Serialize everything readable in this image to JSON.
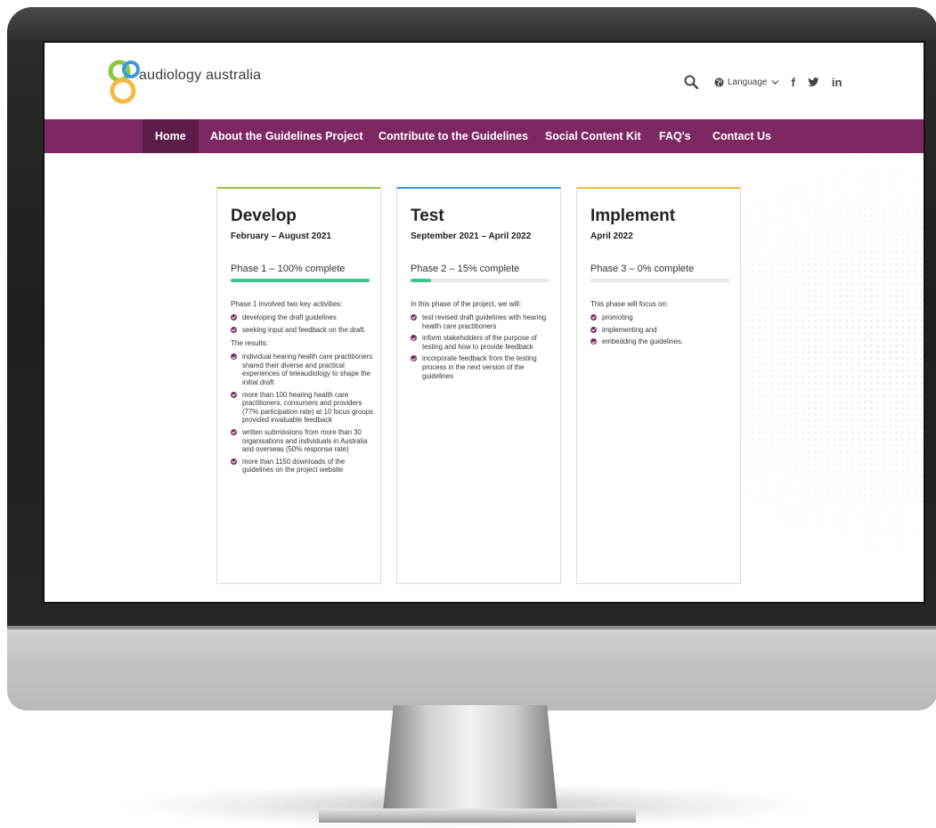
{
  "brand": {
    "name": "audiology australia"
  },
  "header": {
    "language_label": "Language",
    "social": {
      "facebook": "f",
      "linkedin": "in"
    },
    "icons": [
      "search-icon",
      "globe-icon",
      "chevron-down-icon",
      "facebook-icon",
      "twitter-icon",
      "linkedin-icon"
    ]
  },
  "nav": {
    "items": [
      {
        "label": "Home",
        "active": true
      },
      {
        "label": "About the Guidelines Project"
      },
      {
        "label": "Contribute to the Guidelines"
      },
      {
        "label": "Social Content Kit"
      },
      {
        "label": "FAQ's"
      },
      {
        "label": "Contact Us"
      }
    ]
  },
  "colors": {
    "nav_bg": "#7d2862",
    "nav_active_bg": "#5e1c49",
    "progress_fill": "#3cc58f",
    "develop_accent": "#8cc63f",
    "test_accent": "#3a9ad9",
    "implement_accent": "#f4b942"
  },
  "phases": [
    {
      "title": "Develop",
      "dates": "February – August 2021",
      "progress_label": "Phase 1 – 100% complete",
      "progress_percent": 100,
      "intro": "Phase 1 involved two key activities:",
      "items": [
        "developing the draft guidelines",
        "seeking input and feedback on the draft."
      ],
      "results_label": "The results:",
      "results": [
        "individual hearing health care practitioners shared their diverse and practical experiences of teleaudiology to shape the initial draft",
        "more than 100 hearing health care practitioners, consumers and providers (77% participation rate) at 10 focus groups provided invaluable feedback",
        "written submissions from more than 30 organisations and individuals in Australia and overseas (50% response rate)",
        "more than 1150 downloads of the guidelines on the project website"
      ]
    },
    {
      "title": "Test",
      "dates": "September 2021 – April 2022",
      "progress_label": "Phase 2 – 15% complete",
      "progress_percent": 15,
      "intro": "In this phase of the project, we will:",
      "items": [
        "test revised draft guidelines with hearing health care practitioners",
        "inform stakeholders of the purpose of testing and how to provide feedback",
        "incorporate feedback from the testing process in the next version of the guidelines"
      ]
    },
    {
      "title": "Implement",
      "dates": "April 2022",
      "progress_label": "Phase 3 – 0% complete",
      "progress_percent": 0,
      "intro": "This phase will focus on:",
      "items": [
        "promoting",
        "implementing and",
        "embedding the guidelines."
      ]
    }
  ]
}
